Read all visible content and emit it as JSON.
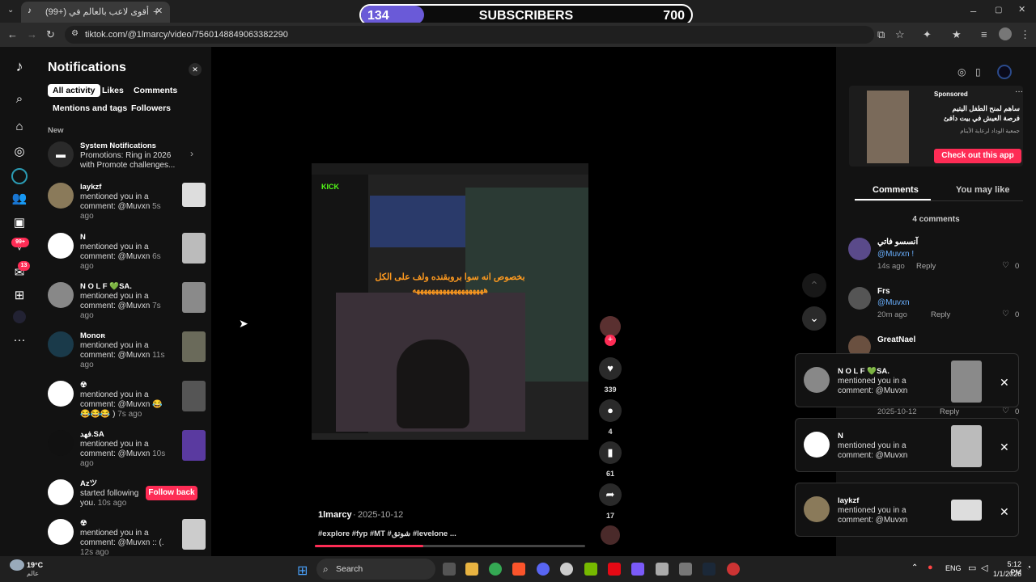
{
  "browser": {
    "tab_title": "(99+) أقوى لاعب بالعالم في",
    "url": "tiktok.com/@1lmarcy/video/7560148849063382290"
  },
  "sub_overlay": {
    "count": "134",
    "label": "SUBSCRIBERS",
    "goal": "700",
    "progress": 0.19
  },
  "rail": {
    "badge_inbox": "99+",
    "badge_messages": "13"
  },
  "notifications": {
    "title": "Notifications",
    "filters": [
      "All activity",
      "Likes",
      "Comments",
      "Mentions and tags",
      "Followers"
    ],
    "section": "New",
    "system": {
      "name": "System Notifications",
      "text": "Promotions: Ring in 2026 with Promote challenges..."
    },
    "items": [
      {
        "name": "laykzf",
        "text": "mentioned you in a comment: @Muvxn",
        "time": "5s ago"
      },
      {
        "name": "N",
        "text": "mentioned you in a comment: @Muvxn",
        "time": "6s ago"
      },
      {
        "name": "N O L F 💚SA.",
        "text": "mentioned you in a comment: @Muvxn",
        "time": "7s ago"
      },
      {
        "name": "Monoʀ",
        "text": "mentioned you in a comment: @Muvxn",
        "time": "11s ago"
      },
      {
        "name": "☢",
        "text": "mentioned you in a comment: @Muvxn 😂😂😂😂 )",
        "time": "7s ago"
      },
      {
        "name": "فهد.SA",
        "text": "mentioned you in a comment: @Muvxn",
        "time": "10s ago"
      },
      {
        "name": "Azツ",
        "text": "started following you.",
        "time": "10s ago"
      },
      {
        "name": "☢",
        "text": "mentioned you in a comment: @Muvxn :: (.",
        "time": "12s ago"
      }
    ],
    "follow_back": "Follow back"
  },
  "video": {
    "overlay_text": "بخصوص انه سوا بروبقنده ولف على الكل",
    "overlay_text2": "هههههههههههههههههههه",
    "author": "1lmarcy",
    "date": "2025-10-12",
    "caption": "#explore #fyp #MT #شوتق #levelone ...",
    "likes": "339",
    "comments": "4",
    "saves": "61",
    "shares": "17"
  },
  "ad": {
    "sponsored": "Sponsored",
    "text": "ساهم لمنح الطفل اليتيم فرصة العيش في بيت دافئ",
    "org": "جمعية الوداد لرعاية الأيتام",
    "cta": "Check out this app"
  },
  "comments_panel": {
    "tab1": "Comments",
    "tab2": "You may like",
    "count_label": "4 comments",
    "items": [
      {
        "name": "آنسسو فاتي",
        "mention": "@Muvxn !",
        "time": "14s ago",
        "reply": "Reply",
        "likes": "0"
      },
      {
        "name": "Frs",
        "mention": "@Muvxn",
        "time": "20m ago",
        "reply": "Reply",
        "likes": "0"
      },
      {
        "name": "GreatNael",
        "mention": "",
        "time": "2025-10-12",
        "reply": "Reply",
        "likes": "0"
      }
    ]
  },
  "toasts": [
    {
      "name": "N O L F 💚SA.",
      "text": "mentioned you in a comment: @Muvxn"
    },
    {
      "name": "N",
      "text": "mentioned you in a comment: @Muvxn"
    },
    {
      "name": "laykzf",
      "text": "mentioned you in a comment: @Muvxn"
    }
  ],
  "taskbar": {
    "weather_temp": "19°C",
    "weather_loc": "عالم",
    "search": "Search",
    "lang": "ENG",
    "time": "5:12 PM",
    "date": "1/1/2026"
  }
}
